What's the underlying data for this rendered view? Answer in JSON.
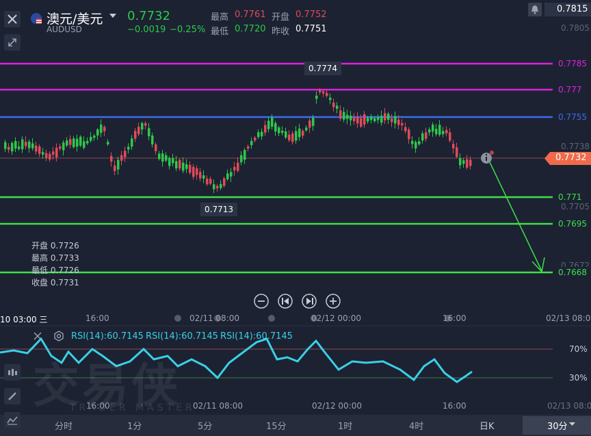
{
  "header": {
    "title": "澳元/美元",
    "symbol": "AUDUSD",
    "price": "0.7732",
    "change": "−0.0019",
    "change_pct": "−0.25%",
    "high_label": "最高",
    "high_value": "0.7761",
    "open_label": "开盘",
    "open_value": "0.7752",
    "low_label": "最低",
    "low_value": "0.7720",
    "prev_label": "昨收",
    "prev_value": "0.7751"
  },
  "price_axis": {
    "top_price": "0.7815",
    "ticks": [
      "0.7805",
      "0.7738",
      "0.7705",
      "0.7672"
    ],
    "current_price": "0.7732"
  },
  "hlines": [
    {
      "label": "0.7785",
      "color": "#e020e0"
    },
    {
      "label": "0.777",
      "color": "#e020e0"
    },
    {
      "label": "0.7755",
      "color": "#3d6cf0"
    },
    {
      "label": "0.771",
      "color": "#3fe04a"
    },
    {
      "label": "0.7695",
      "color": "#3fe04a"
    },
    {
      "label": "0.7668",
      "color": "#3fe04a"
    }
  ],
  "annotations": {
    "peak": "0.7774",
    "trough": "0.7713"
  },
  "ohlc_box": {
    "open": "开盘 0.7726",
    "high": "最高 0.7733",
    "low": "最低 0.7726",
    "close": "收盘 0.7731"
  },
  "x_axis_top": [
    "10 03:00 三",
    "16:00",
    "02/11 08:00",
    "02/12 00:00",
    "16:00",
    "02/13 08:00"
  ],
  "x_axis_bottom": [
    "16:00",
    "02/11 08:00",
    "02/12 00:00",
    "16:00",
    "02/13 08:00"
  ],
  "rsi": {
    "labels": [
      "RSI(14):60.7145",
      "RSI(14):60.7145",
      "RSI(14):60.7145"
    ],
    "level_high": "70%",
    "level_low": "30%"
  },
  "watermark": {
    "main": "交易侠",
    "sub": "TRADER MASTER"
  },
  "timeframes": [
    "分时",
    "1分",
    "5分",
    "15分",
    "1时",
    "4时",
    "日K",
    "30分"
  ],
  "timeframe_selected": "30分",
  "colors": {
    "up": "#e24a5a",
    "down": "#2ec94a",
    "rsi": "#3ad0e6",
    "bg": "#1c2232"
  },
  "icons": [
    "close-icon",
    "collapse-icon",
    "bell-icon",
    "info-icon",
    "zoom-out-icon",
    "prev-icon",
    "next-icon",
    "zoom-in-icon",
    "settings-icon",
    "candle-type-icon",
    "draw-icon",
    "indicator-icon",
    "dropdown-icon",
    "au-us-flag-icon"
  ]
}
